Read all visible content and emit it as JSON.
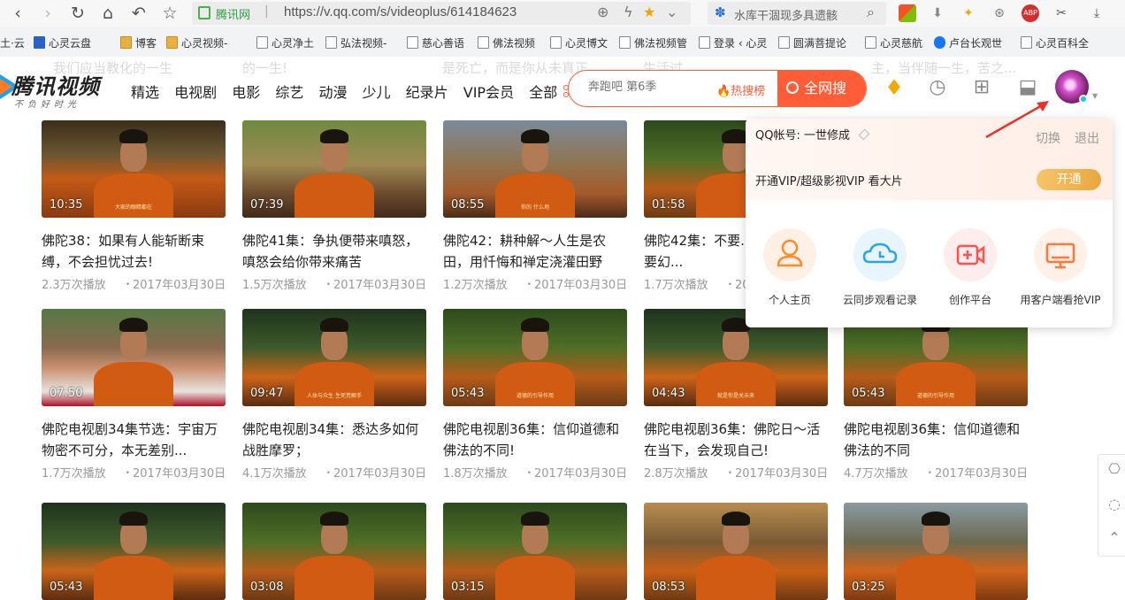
{
  "browser": {
    "site_name": "腾讯网",
    "url": "https://v.qq.com/s/videoplus/614184623",
    "search_text": "水库干涸现多具遗骸",
    "bookmarks": [
      {
        "label": "土·云",
        "icon": "folder"
      },
      {
        "label": "心灵云盘",
        "icon": "k-icon"
      },
      {
        "label": "博客",
        "icon": "image-icon"
      },
      {
        "label": "心灵视频-",
        "icon": "image-icon"
      },
      {
        "label": "心灵净土",
        "icon": "page-icon"
      },
      {
        "label": "弘法视频-",
        "icon": "page-icon"
      },
      {
        "label": "慈心善语",
        "icon": "page-icon"
      },
      {
        "label": "佛法视频",
        "icon": "page-icon"
      },
      {
        "label": "心灵博文",
        "icon": "page-icon"
      },
      {
        "label": "佛法视频管",
        "icon": "page-icon"
      },
      {
        "label": "登录 ‹ 心灵",
        "icon": "page-icon"
      },
      {
        "label": "圆满菩提论",
        "icon": "page-icon"
      },
      {
        "label": "心灵慈航",
        "icon": "page-icon"
      },
      {
        "label": "卢台长观世",
        "icon": "facebook-icon"
      },
      {
        "label": "心灵百科全",
        "icon": "page-icon"
      }
    ]
  },
  "header": {
    "ghost_texts": [
      "我们应当教化的一生",
      "的一生!",
      "是死亡，而是你从未真正",
      "生活过",
      "主，当伴随一生，苦之..."
    ],
    "logo_name": "腾讯视频",
    "logo_slogan": "不负好时光",
    "nav": [
      "精选",
      "电视剧",
      "电影",
      "综艺",
      "动漫",
      "少儿",
      "纪录片",
      "VIP会员",
      "全部"
    ],
    "search_placeholder": "奔跑吧 第6季",
    "hot_label": "热搜榜",
    "search_button": "全网搜"
  },
  "videos": [
    {
      "duration": "10:35",
      "title": "佛陀38：如果有人能斩断束缚，不会担忧过去!",
      "plays": "2.3万次播放",
      "date": "2017年03月30日",
      "caption": "大家的眼睛都在"
    },
    {
      "duration": "07:39",
      "title": "佛陀41集：争执便带来嗔怒，嗔怒会给你带来痛苦",
      "plays": "1.5万次播放",
      "date": "2017年03月30日",
      "caption": ""
    },
    {
      "duration": "08:55",
      "title": "佛陀42：耕种解～人生是农田，用忏悔和禅定浇灌田野",
      "plays": "1.2万次播放",
      "date": "2017年03月30日",
      "caption": "你的 什么地"
    },
    {
      "duration": "01:58",
      "title": "佛陀42集：不要...事物，也不要幻...",
      "plays": "1.7万次播放",
      "date": "2017...",
      "caption": ""
    },
    {
      "duration": "07:50",
      "title": "佛陀电视剧34集节选：宇宙万物密不可分，本无差别...",
      "plays": "1.7万次播放",
      "date": "2017年03月30日",
      "caption": ""
    },
    {
      "duration": "09:47",
      "title": "佛陀电视剧34集：悉达多如何战胜摩罗；",
      "plays": "4.1万次播放",
      "date": "2017年03月30日",
      "caption": "人体与众生 生死荒解手"
    },
    {
      "duration": "05:43",
      "title": "佛陀电视剧36集：信仰道德和佛法的不同!",
      "plays": "1.8万次播放",
      "date": "2017年03月30日",
      "caption": "道德的引导作用"
    },
    {
      "duration": "04:43",
      "title": "佛陀电视剧36集：佛陀日～活在当下，会发现自己!",
      "plays": "2.8万次播放",
      "date": "2017年03月30日",
      "caption": "就是你是关未来"
    },
    {
      "duration": "05:43",
      "title": "佛陀电视剧36集：信仰道德和佛法的不同",
      "plays": "4.7万次播放",
      "date": "2017年03月30日",
      "caption": "道德的引导作用"
    },
    {
      "duration": "05:43",
      "title": "",
      "plays": "",
      "date": "",
      "caption": ""
    },
    {
      "duration": "03:08",
      "title": "",
      "plays": "",
      "date": "",
      "caption": ""
    },
    {
      "duration": "03:15",
      "title": "",
      "plays": "",
      "date": "",
      "caption": ""
    },
    {
      "duration": "08:53",
      "title": "",
      "plays": "",
      "date": "",
      "caption": ""
    },
    {
      "duration": "03:25",
      "title": "",
      "plays": "",
      "date": "",
      "caption": ""
    }
  ],
  "user_panel": {
    "account_label": "QQ帐号: 一世修成",
    "switch": "切换",
    "logout": "退出",
    "vip_text": "开通VIP/超级影视VIP 看大片",
    "open_button": "开通",
    "quick_actions": [
      {
        "label": "个人主页",
        "icon": "person-icon",
        "color": "#ff8a2b"
      },
      {
        "label": "云同步观看记录",
        "icon": "cloud-clock-icon",
        "color": "#2aa6e8"
      },
      {
        "label": "创作平台",
        "icon": "video-plus-icon",
        "color": "#ff5050"
      },
      {
        "label": "用客户端看抢VIP",
        "icon": "monitor-icon",
        "color": "#ff7a3a"
      }
    ]
  },
  "colors": {
    "accent": "#ff5c38",
    "vip_gold": "#e9a73c",
    "arrow_red": "#e8332a"
  }
}
